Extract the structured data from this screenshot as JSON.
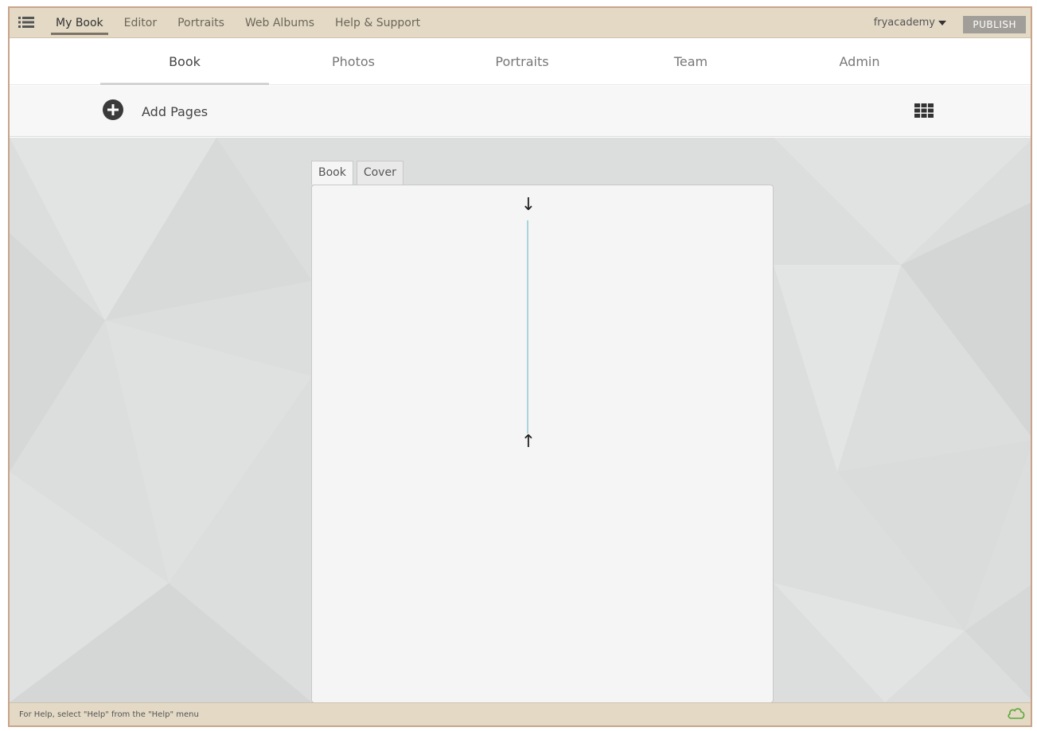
{
  "menubar": {
    "items": [
      {
        "label": "My Book",
        "active": true
      },
      {
        "label": "Editor",
        "active": false
      },
      {
        "label": "Portraits",
        "active": false
      },
      {
        "label": "Web Albums",
        "active": false
      },
      {
        "label": "Help & Support",
        "active": false
      }
    ],
    "user": "fryacademy",
    "publish_label": "PUBLISH"
  },
  "tabs": [
    {
      "label": "Book",
      "active": true
    },
    {
      "label": "Photos",
      "active": false
    },
    {
      "label": "Portraits",
      "active": false
    },
    {
      "label": "Team",
      "active": false
    },
    {
      "label": "Admin",
      "active": false
    }
  ],
  "toolbar": {
    "add_pages_label": "Add Pages",
    "add_icon": "plus-circle-icon",
    "view_icon": "grid-view-icon"
  },
  "editor": {
    "doc_tabs": [
      {
        "label": "Book",
        "active": true
      },
      {
        "label": "Cover",
        "active": false
      }
    ],
    "arrow_top": "↓",
    "arrow_bottom": "↑"
  },
  "statusbar": {
    "text": "For Help, select \"Help\" from the \"Help\" menu",
    "cloud_icon": "cloud-icon"
  },
  "colors": {
    "menubar_bg": "#e3d9c5",
    "frame_border": "#c9a48b",
    "publish_bg": "#a19d98",
    "guide_line": "#a8d4dd",
    "cloud": "#5aa83a"
  }
}
